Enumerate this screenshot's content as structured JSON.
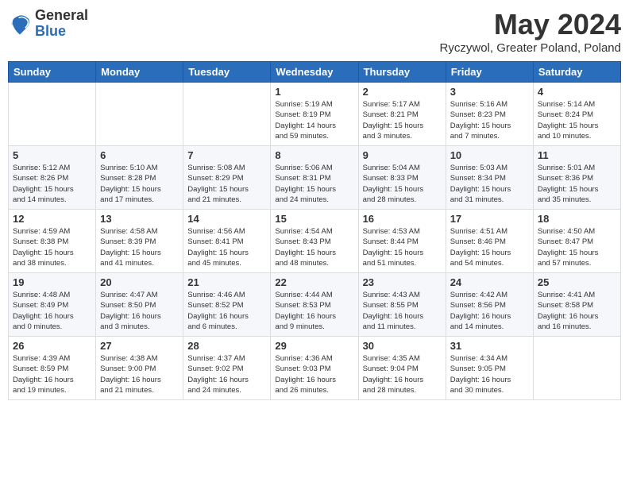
{
  "logo": {
    "general": "General",
    "blue": "Blue"
  },
  "header": {
    "month_title": "May 2024",
    "subtitle": "Ryczywol, Greater Poland, Poland"
  },
  "weekdays": [
    "Sunday",
    "Monday",
    "Tuesday",
    "Wednesday",
    "Thursday",
    "Friday",
    "Saturday"
  ],
  "weeks": [
    [
      {
        "day": "",
        "info": ""
      },
      {
        "day": "",
        "info": ""
      },
      {
        "day": "",
        "info": ""
      },
      {
        "day": "1",
        "info": "Sunrise: 5:19 AM\nSunset: 8:19 PM\nDaylight: 14 hours\nand 59 minutes."
      },
      {
        "day": "2",
        "info": "Sunrise: 5:17 AM\nSunset: 8:21 PM\nDaylight: 15 hours\nand 3 minutes."
      },
      {
        "day": "3",
        "info": "Sunrise: 5:16 AM\nSunset: 8:23 PM\nDaylight: 15 hours\nand 7 minutes."
      },
      {
        "day": "4",
        "info": "Sunrise: 5:14 AM\nSunset: 8:24 PM\nDaylight: 15 hours\nand 10 minutes."
      }
    ],
    [
      {
        "day": "5",
        "info": "Sunrise: 5:12 AM\nSunset: 8:26 PM\nDaylight: 15 hours\nand 14 minutes."
      },
      {
        "day": "6",
        "info": "Sunrise: 5:10 AM\nSunset: 8:28 PM\nDaylight: 15 hours\nand 17 minutes."
      },
      {
        "day": "7",
        "info": "Sunrise: 5:08 AM\nSunset: 8:29 PM\nDaylight: 15 hours\nand 21 minutes."
      },
      {
        "day": "8",
        "info": "Sunrise: 5:06 AM\nSunset: 8:31 PM\nDaylight: 15 hours\nand 24 minutes."
      },
      {
        "day": "9",
        "info": "Sunrise: 5:04 AM\nSunset: 8:33 PM\nDaylight: 15 hours\nand 28 minutes."
      },
      {
        "day": "10",
        "info": "Sunrise: 5:03 AM\nSunset: 8:34 PM\nDaylight: 15 hours\nand 31 minutes."
      },
      {
        "day": "11",
        "info": "Sunrise: 5:01 AM\nSunset: 8:36 PM\nDaylight: 15 hours\nand 35 minutes."
      }
    ],
    [
      {
        "day": "12",
        "info": "Sunrise: 4:59 AM\nSunset: 8:38 PM\nDaylight: 15 hours\nand 38 minutes."
      },
      {
        "day": "13",
        "info": "Sunrise: 4:58 AM\nSunset: 8:39 PM\nDaylight: 15 hours\nand 41 minutes."
      },
      {
        "day": "14",
        "info": "Sunrise: 4:56 AM\nSunset: 8:41 PM\nDaylight: 15 hours\nand 45 minutes."
      },
      {
        "day": "15",
        "info": "Sunrise: 4:54 AM\nSunset: 8:43 PM\nDaylight: 15 hours\nand 48 minutes."
      },
      {
        "day": "16",
        "info": "Sunrise: 4:53 AM\nSunset: 8:44 PM\nDaylight: 15 hours\nand 51 minutes."
      },
      {
        "day": "17",
        "info": "Sunrise: 4:51 AM\nSunset: 8:46 PM\nDaylight: 15 hours\nand 54 minutes."
      },
      {
        "day": "18",
        "info": "Sunrise: 4:50 AM\nSunset: 8:47 PM\nDaylight: 15 hours\nand 57 minutes."
      }
    ],
    [
      {
        "day": "19",
        "info": "Sunrise: 4:48 AM\nSunset: 8:49 PM\nDaylight: 16 hours\nand 0 minutes."
      },
      {
        "day": "20",
        "info": "Sunrise: 4:47 AM\nSunset: 8:50 PM\nDaylight: 16 hours\nand 3 minutes."
      },
      {
        "day": "21",
        "info": "Sunrise: 4:46 AM\nSunset: 8:52 PM\nDaylight: 16 hours\nand 6 minutes."
      },
      {
        "day": "22",
        "info": "Sunrise: 4:44 AM\nSunset: 8:53 PM\nDaylight: 16 hours\nand 9 minutes."
      },
      {
        "day": "23",
        "info": "Sunrise: 4:43 AM\nSunset: 8:55 PM\nDaylight: 16 hours\nand 11 minutes."
      },
      {
        "day": "24",
        "info": "Sunrise: 4:42 AM\nSunset: 8:56 PM\nDaylight: 16 hours\nand 14 minutes."
      },
      {
        "day": "25",
        "info": "Sunrise: 4:41 AM\nSunset: 8:58 PM\nDaylight: 16 hours\nand 16 minutes."
      }
    ],
    [
      {
        "day": "26",
        "info": "Sunrise: 4:39 AM\nSunset: 8:59 PM\nDaylight: 16 hours\nand 19 minutes."
      },
      {
        "day": "27",
        "info": "Sunrise: 4:38 AM\nSunset: 9:00 PM\nDaylight: 16 hours\nand 21 minutes."
      },
      {
        "day": "28",
        "info": "Sunrise: 4:37 AM\nSunset: 9:02 PM\nDaylight: 16 hours\nand 24 minutes."
      },
      {
        "day": "29",
        "info": "Sunrise: 4:36 AM\nSunset: 9:03 PM\nDaylight: 16 hours\nand 26 minutes."
      },
      {
        "day": "30",
        "info": "Sunrise: 4:35 AM\nSunset: 9:04 PM\nDaylight: 16 hours\nand 28 minutes."
      },
      {
        "day": "31",
        "info": "Sunrise: 4:34 AM\nSunset: 9:05 PM\nDaylight: 16 hours\nand 30 minutes."
      },
      {
        "day": "",
        "info": ""
      }
    ]
  ]
}
